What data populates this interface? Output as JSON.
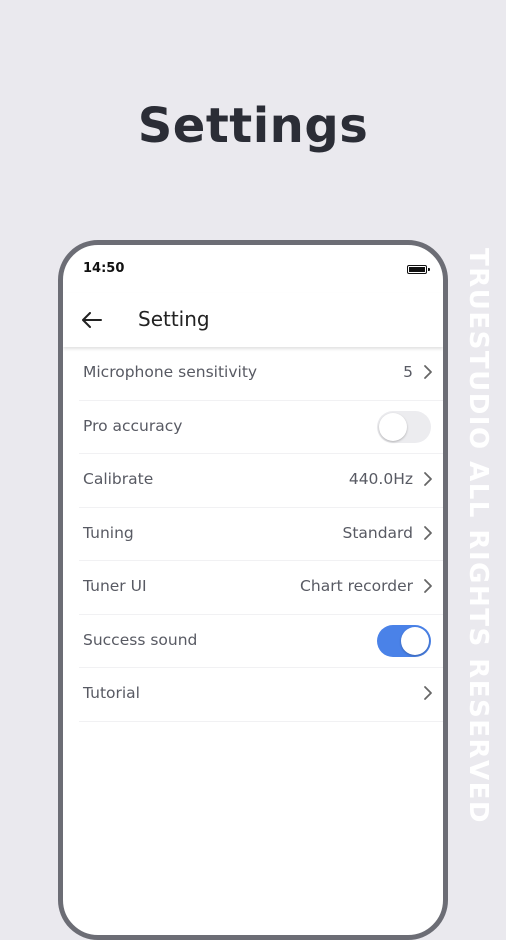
{
  "promo": {
    "title": "Settings",
    "watermark": "TRUESTUDIO ALL RIGHTS RESERVED"
  },
  "status_bar": {
    "time": "14:50",
    "battery_icon": "battery-full-icon"
  },
  "app_bar": {
    "back_icon": "arrow-left-icon",
    "title": "Setting"
  },
  "settings": {
    "items": [
      {
        "label": "Microphone sensitivity",
        "value": "5",
        "control": "chevron"
      },
      {
        "label": "Pro accuracy",
        "value": "",
        "control": "toggle",
        "on": false
      },
      {
        "label": "Calibrate",
        "value": "440.0Hz",
        "control": "chevron"
      },
      {
        "label": "Tuning",
        "value": "Standard",
        "control": "chevron"
      },
      {
        "label": "Tuner UI",
        "value": "Chart recorder",
        "control": "chevron"
      },
      {
        "label": "Success sound",
        "value": "",
        "control": "toggle",
        "on": true
      },
      {
        "label": "Tutorial",
        "value": "",
        "control": "chevron"
      }
    ]
  },
  "colors": {
    "background": "#eae9ee",
    "toggle_on": "#4a82e8",
    "toggle_off": "#ececef",
    "text": "#585a63"
  }
}
